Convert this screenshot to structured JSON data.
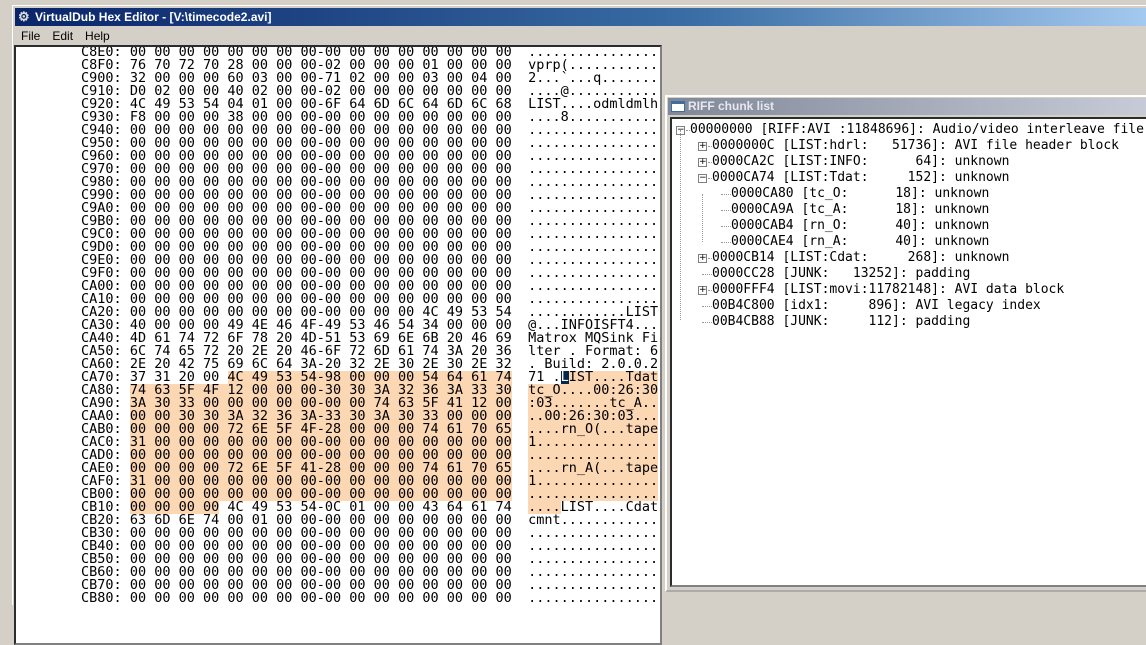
{
  "window": {
    "title": "VirtualDub Hex Editor - [V:\\timecode2.avi]"
  },
  "menu": [
    "File",
    "Edit",
    "Help"
  ],
  "hex": {
    "highlight": {
      "start": "CA74",
      "end": "CB13",
      "color": "#fcd7b4"
    },
    "cursor": "CA74",
    "rows": [
      {
        "addr": "C8E0",
        "hex": "00 00 00 00 00 00 00 00-00 00 00 00 00 00 00 00",
        "ascii": "................"
      },
      {
        "addr": "C8F0",
        "hex": "76 70 72 70 28 00 00 00-02 00 00 00 01 00 00 00",
        "ascii": "vprp(..........."
      },
      {
        "addr": "C900",
        "hex": "32 00 00 00 60 03 00 00-71 02 00 00 03 00 04 00",
        "ascii": "2...`...q......."
      },
      {
        "addr": "C910",
        "hex": "D0 02 00 00 40 02 00 00-02 00 00 00 00 00 00 00",
        "ascii": "....@..........."
      },
      {
        "addr": "C920",
        "hex": "4C 49 53 54 04 01 00 00-6F 64 6D 6C 64 6D 6C 68",
        "ascii": "LIST....odmldmlh"
      },
      {
        "addr": "C930",
        "hex": "F8 00 00 00 38 00 00 00-00 00 00 00 00 00 00 00",
        "ascii": "....8..........."
      },
      {
        "addr": "C940",
        "hex": "00 00 00 00 00 00 00 00-00 00 00 00 00 00 00 00",
        "ascii": "................"
      },
      {
        "addr": "C950",
        "hex": "00 00 00 00 00 00 00 00-00 00 00 00 00 00 00 00",
        "ascii": "................"
      },
      {
        "addr": "C960",
        "hex": "00 00 00 00 00 00 00 00-00 00 00 00 00 00 00 00",
        "ascii": "................"
      },
      {
        "addr": "C970",
        "hex": "00 00 00 00 00 00 00 00-00 00 00 00 00 00 00 00",
        "ascii": "................"
      },
      {
        "addr": "C980",
        "hex": "00 00 00 00 00 00 00 00-00 00 00 00 00 00 00 00",
        "ascii": "................"
      },
      {
        "addr": "C990",
        "hex": "00 00 00 00 00 00 00 00-00 00 00 00 00 00 00 00",
        "ascii": "................"
      },
      {
        "addr": "C9A0",
        "hex": "00 00 00 00 00 00 00 00-00 00 00 00 00 00 00 00",
        "ascii": "................"
      },
      {
        "addr": "C9B0",
        "hex": "00 00 00 00 00 00 00 00-00 00 00 00 00 00 00 00",
        "ascii": "................"
      },
      {
        "addr": "C9C0",
        "hex": "00 00 00 00 00 00 00 00-00 00 00 00 00 00 00 00",
        "ascii": "................"
      },
      {
        "addr": "C9D0",
        "hex": "00 00 00 00 00 00 00 00-00 00 00 00 00 00 00 00",
        "ascii": "................"
      },
      {
        "addr": "C9E0",
        "hex": "00 00 00 00 00 00 00 00-00 00 00 00 00 00 00 00",
        "ascii": "................"
      },
      {
        "addr": "C9F0",
        "hex": "00 00 00 00 00 00 00 00-00 00 00 00 00 00 00 00",
        "ascii": "................"
      },
      {
        "addr": "CA00",
        "hex": "00 00 00 00 00 00 00 00-00 00 00 00 00 00 00 00",
        "ascii": "................"
      },
      {
        "addr": "CA10",
        "hex": "00 00 00 00 00 00 00 00-00 00 00 00 00 00 00 00",
        "ascii": "................"
      },
      {
        "addr": "CA20",
        "hex": "00 00 00 00 00 00 00 00-00 00 00 00 4C 49 53 54",
        "ascii": "............LIST"
      },
      {
        "addr": "CA30",
        "hex": "40 00 00 00 49 4E 46 4F-49 53 46 54 34 00 00 00",
        "ascii": "@...INFOISFT4..."
      },
      {
        "addr": "CA40",
        "hex": "4D 61 74 72 6F 78 20 4D-51 53 69 6E 6B 20 46 69",
        "ascii": "Matrox MQSink Fi"
      },
      {
        "addr": "CA50",
        "hex": "6C 74 65 72 20 2E 20 46-6F 72 6D 61 74 3A 20 36",
        "ascii": "lter . Format: 6"
      },
      {
        "addr": "CA60",
        "hex": "2E 20 42 75 69 6C 64 3A-20 32 2E 30 2E 30 2E 32",
        "ascii": ". Build: 2.0.0.2"
      },
      {
        "addr": "CA70",
        "hex": "37 31 20 00 4C 49 53 54-98 00 00 00 54 64 61 74",
        "ascii": "71 .LIST....Tdat"
      },
      {
        "addr": "CA80",
        "hex": "74 63 5F 4F 12 00 00 00-30 30 3A 32 36 3A 33 30",
        "ascii": "tc_O....00:26:30"
      },
      {
        "addr": "CA90",
        "hex": "3A 30 33 00 00 00 00 00-00 00 74 63 5F 41 12 00",
        "ascii": ":03.......tc_A.."
      },
      {
        "addr": "CAA0",
        "hex": "00 00 30 30 3A 32 36 3A-33 30 3A 30 33 00 00 00",
        "ascii": "..00:26:30:03..."
      },
      {
        "addr": "CAB0",
        "hex": "00 00 00 00 72 6E 5F 4F-28 00 00 00 74 61 70 65",
        "ascii": "....rn_O(...tape"
      },
      {
        "addr": "CAC0",
        "hex": "31 00 00 00 00 00 00 00-00 00 00 00 00 00 00 00",
        "ascii": "1..............."
      },
      {
        "addr": "CAD0",
        "hex": "00 00 00 00 00 00 00 00-00 00 00 00 00 00 00 00",
        "ascii": "................"
      },
      {
        "addr": "CAE0",
        "hex": "00 00 00 00 72 6E 5F 41-28 00 00 00 74 61 70 65",
        "ascii": "....rn_A(...tape"
      },
      {
        "addr": "CAF0",
        "hex": "31 00 00 00 00 00 00 00-00 00 00 00 00 00 00 00",
        "ascii": "1..............."
      },
      {
        "addr": "CB00",
        "hex": "00 00 00 00 00 00 00 00-00 00 00 00 00 00 00 00",
        "ascii": "................"
      },
      {
        "addr": "CB10",
        "hex": "00 00 00 00 4C 49 53 54-0C 01 00 00 43 64 61 74",
        "ascii": "....LIST....Cdat"
      },
      {
        "addr": "CB20",
        "hex": "63 6D 6E 74 00 01 00 00-00 00 00 00 00 00 00 00",
        "ascii": "cmnt............"
      },
      {
        "addr": "CB30",
        "hex": "00 00 00 00 00 00 00 00-00 00 00 00 00 00 00 00",
        "ascii": "................"
      },
      {
        "addr": "CB40",
        "hex": "00 00 00 00 00 00 00 00-00 00 00 00 00 00 00 00",
        "ascii": "................"
      },
      {
        "addr": "CB50",
        "hex": "00 00 00 00 00 00 00 00-00 00 00 00 00 00 00 00",
        "ascii": "................"
      },
      {
        "addr": "CB60",
        "hex": "00 00 00 00 00 00 00 00-00 00 00 00 00 00 00 00",
        "ascii": "................"
      },
      {
        "addr": "CB70",
        "hex": "00 00 00 00 00 00 00 00-00 00 00 00 00 00 00 00",
        "ascii": "................"
      },
      {
        "addr": "CB80",
        "hex": "00 00 00 00 00 00 00 00-00 00 00 00 00 00 00 00",
        "ascii": "................"
      }
    ]
  },
  "chunk_list": {
    "title": "RIFF chunk list",
    "items": [
      {
        "depth": 0,
        "expander": "minus",
        "text": "00000000 [RIFF:AVI :11848696]: Audio/video interleave file"
      },
      {
        "depth": 1,
        "expander": "plus",
        "text": "0000000C [LIST:hdrl:   51736]: AVI file header block"
      },
      {
        "depth": 1,
        "expander": "plus",
        "text": "0000CA2C [LIST:INFO:      64]: unknown"
      },
      {
        "depth": 1,
        "expander": "minus",
        "text": "0000CA74 [LIST:Tdat:     152]: unknown"
      },
      {
        "depth": 2,
        "expander": "none",
        "text": "0000CA80 [tc_O:      18]: unknown"
      },
      {
        "depth": 2,
        "expander": "none",
        "text": "0000CA9A [tc_A:      18]: unknown"
      },
      {
        "depth": 2,
        "expander": "none",
        "text": "0000CAB4 [rn_O:      40]: unknown"
      },
      {
        "depth": 2,
        "expander": "none",
        "text": "0000CAE4 [rn_A:      40]: unknown"
      },
      {
        "depth": 1,
        "expander": "plus",
        "text": "0000CB14 [LIST:Cdat:     268]: unknown"
      },
      {
        "depth": 1,
        "expander": "none",
        "text": "0000CC28 [JUNK:   13252]: padding"
      },
      {
        "depth": 1,
        "expander": "plus",
        "text": "0000FFF4 [LIST:movi:11782148]: AVI data block"
      },
      {
        "depth": 1,
        "expander": "none",
        "text": "00B4C800 [idx1:     896]: AVI legacy index"
      },
      {
        "depth": 1,
        "expander": "none",
        "text": "00B4CB88 [JUNK:     112]: padding"
      }
    ]
  }
}
